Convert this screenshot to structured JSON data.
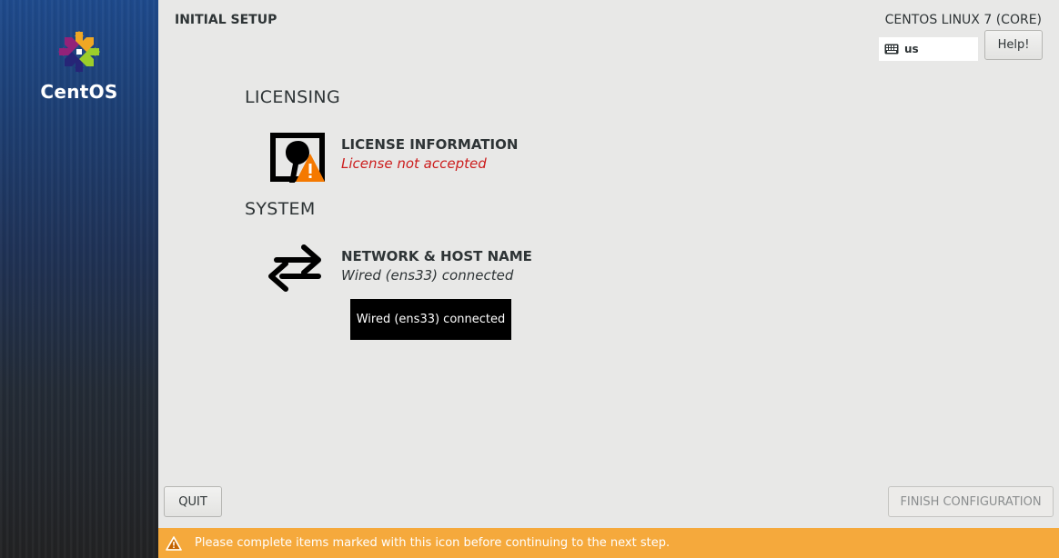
{
  "sidebar": {
    "brand": "CentOS",
    "logo_icon": "centos-logo-icon"
  },
  "header": {
    "title": "INITIAL SETUP",
    "product": "CENTOS LINUX 7 (CORE)",
    "keyboard_layout": "us",
    "keyboard_icon": "keyboard-icon",
    "help_label": "Help!"
  },
  "sections": {
    "licensing": {
      "title": "LICENSING",
      "license": {
        "title": "LICENSE INFORMATION",
        "status": "License not accepted",
        "icon": "license-warning-icon",
        "status_color": "#cc1d1d"
      }
    },
    "system": {
      "title": "SYSTEM",
      "network": {
        "title": "NETWORK & HOST NAME",
        "status": "Wired (ens33) connected",
        "icon": "network-arrows-icon"
      }
    }
  },
  "tooltip": {
    "text": "Wired (ens33) connected"
  },
  "footer": {
    "quit_label": "QUIT",
    "finish_label": "FINISH CONFIGURATION"
  },
  "warning": {
    "text": "Please complete items marked with this icon before continuing to the next step.",
    "icon": "warning-icon",
    "color": "#f5a93c"
  }
}
